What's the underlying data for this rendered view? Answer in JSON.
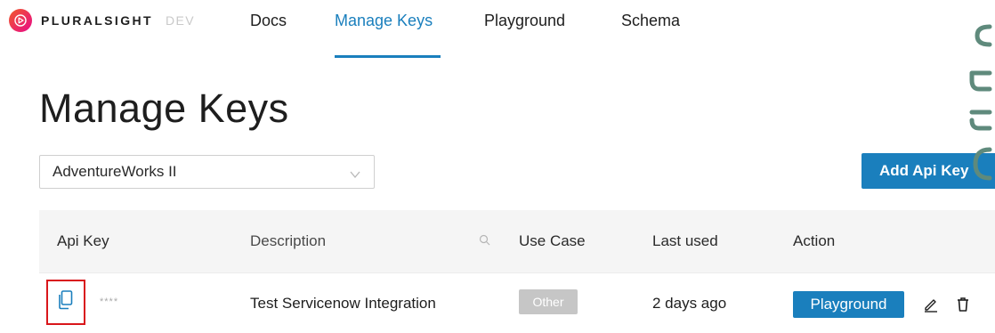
{
  "brand": {
    "name": "PLURALSIGHT",
    "suffix": "DEV",
    "logo_icon": "play-triangle-in-circle",
    "logo_colors": [
      "#f15b2a",
      "#e80a89"
    ]
  },
  "nav": {
    "tabs": [
      {
        "label": "Docs",
        "active": false
      },
      {
        "label": "Manage Keys",
        "active": true
      },
      {
        "label": "Playground",
        "active": false
      },
      {
        "label": "Schema",
        "active": false
      }
    ]
  },
  "page": {
    "title": "Manage Keys"
  },
  "org_select": {
    "value": "AdventureWorks II",
    "icon": "chevron-down-icon"
  },
  "add_button": {
    "label": "Add Api Key"
  },
  "table": {
    "headers": {
      "api_key": "Api Key",
      "description": "Description",
      "use_case": "Use Case",
      "last_used": "Last used",
      "action": "Action"
    },
    "rows": [
      {
        "api_key_masked": "****",
        "description": "Test Servicenow Integration",
        "use_case": "Other",
        "last_used": "2 days ago",
        "action_label": "Playground"
      }
    ]
  },
  "colors": {
    "accent": "#1a7fbd",
    "highlight_box": "#d9161b",
    "badge_gray": "#c6c6c6",
    "edge_decoration": "#5f8a7c"
  }
}
